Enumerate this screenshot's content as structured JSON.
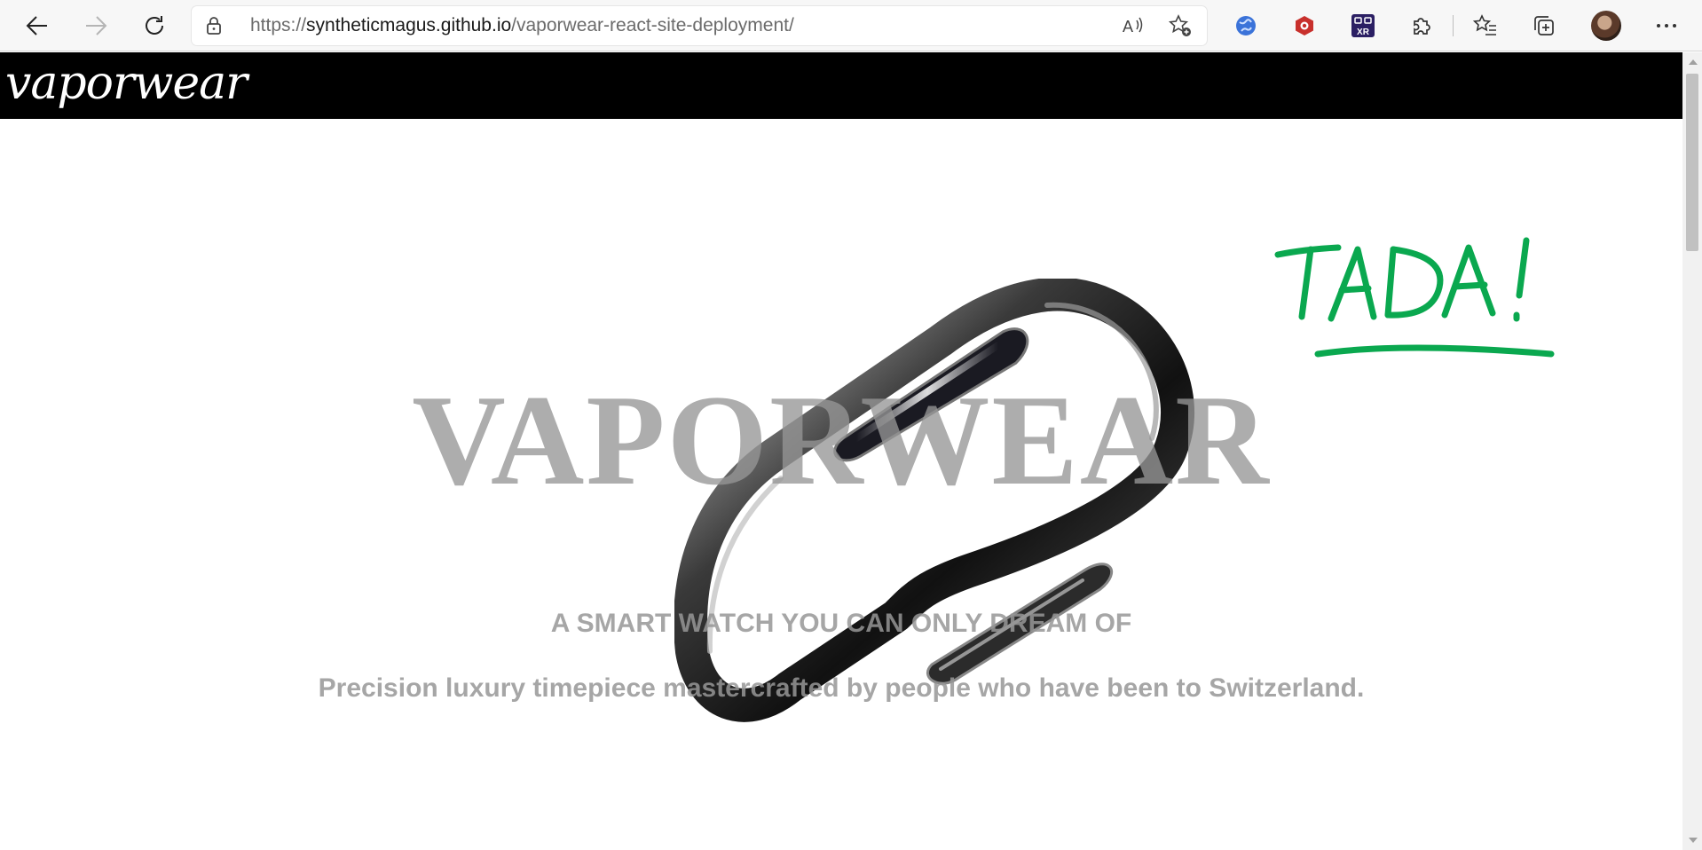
{
  "browser": {
    "url_base": "https://",
    "url_host": "syntheticmagus.github.io",
    "url_path": "/vaporwear-react-site-deployment/",
    "read_aloud_icon": "read-aloud-icon",
    "add_favorite_icon": "add-favorite-icon",
    "extensions": [
      "globe-extension-icon",
      "hexagon-extension-icon",
      "xr-extension-icon",
      "puzzle-extensions-icon"
    ],
    "xr_label": "XR"
  },
  "site": {
    "brand": "vaporwear"
  },
  "hero": {
    "title": "VAPORWEAR",
    "subtitle": "A SMART WATCH YOU CAN ONLY DREAM OF",
    "description": "Precision luxury timepiece mastercrafted by people who have been to Switzerland."
  },
  "annotation": {
    "text": "TADA!",
    "color": "#0aa84f"
  },
  "colors": {
    "header_bg": "#000000",
    "hero_text": "#969696"
  }
}
